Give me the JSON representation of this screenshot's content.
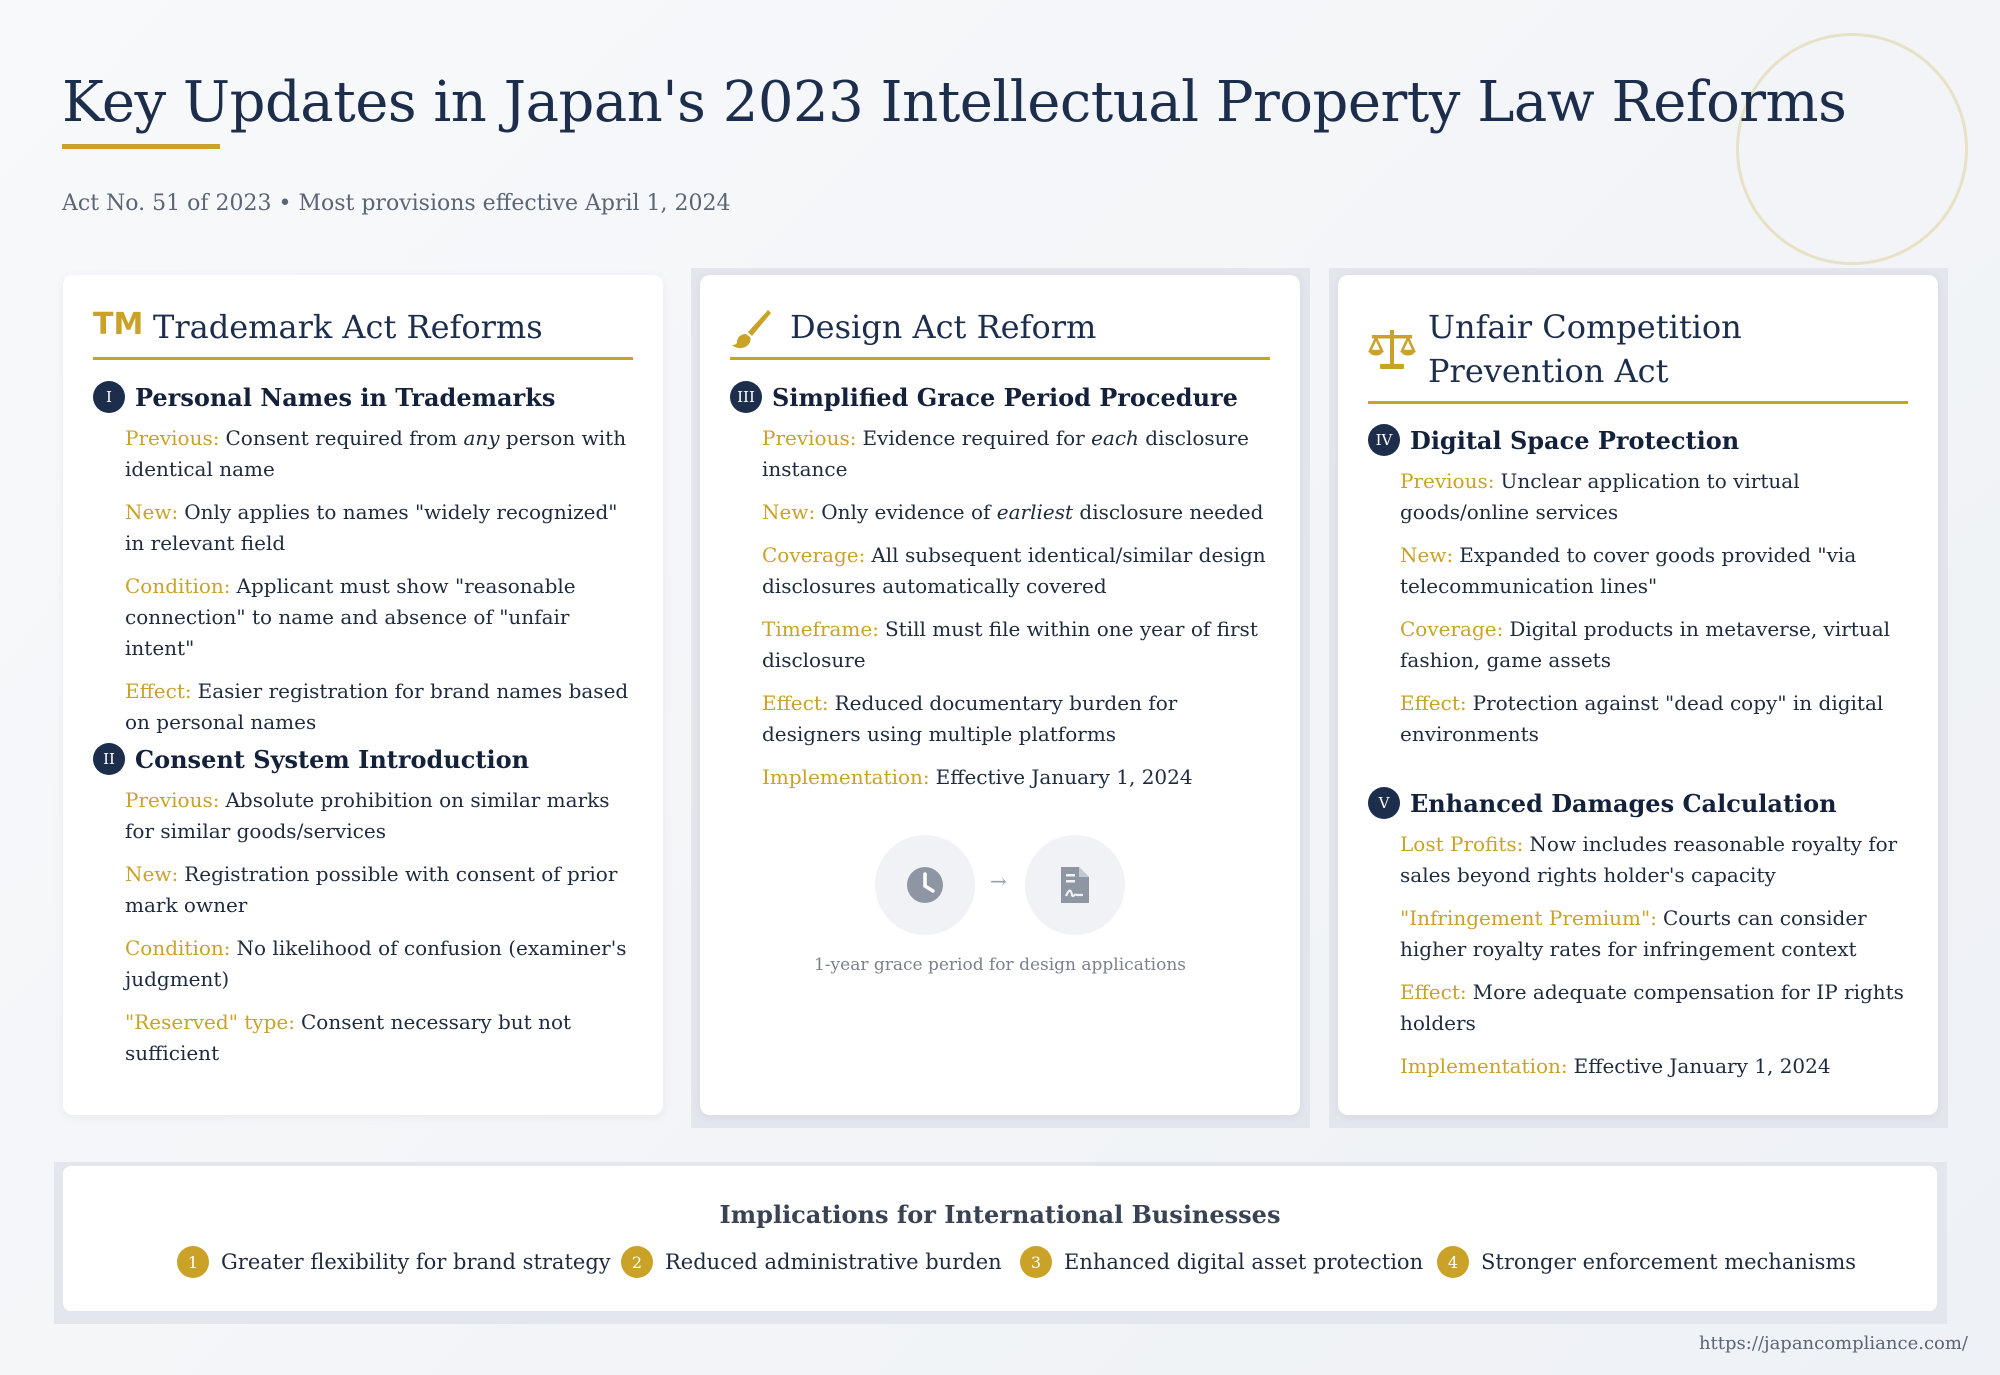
{
  "header": {
    "title": "Key Updates in Japan's 2023 Intellectual Property Law Reforms",
    "subtitle": "Act No. 51 of 2023 • Most provisions effective April 1, 2024"
  },
  "colors": {
    "navy": "#1c2e4c",
    "gold": "#c9a227"
  },
  "cards": {
    "trademark": {
      "icon": "trademark-icon",
      "icon_text": "TM",
      "title": "Trademark Act Reforms",
      "sections": [
        {
          "num": "I",
          "title": "Personal Names in Trademarks",
          "items": [
            {
              "label": "Previous:",
              "pre": "Consent required from ",
              "em": "any",
              "post": " person with identical name"
            },
            {
              "label": "New:",
              "text": "Only applies to names \"widely recognized\" in relevant field"
            },
            {
              "label": "Condition:",
              "text": "Applicant must show \"reasonable connection\" to name and absence of \"unfair intent\""
            },
            {
              "label": "Effect:",
              "text": "Easier registration for brand names based on personal names"
            }
          ]
        },
        {
          "num": "II",
          "title": "Consent System Introduction",
          "items": [
            {
              "label": "Previous:",
              "text": "Absolute prohibition on similar marks for similar goods/services"
            },
            {
              "label": "New:",
              "text": "Registration possible with consent of prior mark owner"
            },
            {
              "label": "Condition:",
              "text": "No likelihood of confusion (examiner's judgment)"
            },
            {
              "label": "\"Reserved\" type:",
              "text": "Consent necessary but not sufficient"
            }
          ]
        }
      ]
    },
    "design": {
      "icon": "paintbrush-icon",
      "title": "Design Act Reform",
      "sections": [
        {
          "num": "III",
          "title": "Simplified Grace Period Procedure",
          "items": [
            {
              "label": "Previous:",
              "pre": "Evidence required for ",
              "em": "each",
              "post": " disclosure instance"
            },
            {
              "label": "New:",
              "pre": "Only evidence of ",
              "em": "earliest",
              "post": " disclosure needed"
            },
            {
              "label": "Coverage:",
              "text": "All subsequent identical/similar design disclosures automatically covered"
            },
            {
              "label": "Timeframe:",
              "text": "Still must file within one year of first disclosure"
            },
            {
              "label": "Effect:",
              "text": "Reduced documentary burden for designers using multiple platforms"
            },
            {
              "label": "Implementation:",
              "text": "Effective January 1, 2024"
            }
          ]
        }
      ],
      "graphic": {
        "left_icon": "clock-icon",
        "arrow": "→",
        "right_icon": "signed-document-icon",
        "caption": "1-year grace period for design applications"
      }
    },
    "unfair": {
      "icon": "scales-icon",
      "title": "Unfair Competition Prevention Act",
      "sections": [
        {
          "num": "IV",
          "title": "Digital Space Protection",
          "items": [
            {
              "label": "Previous:",
              "text": "Unclear application to virtual goods/online services"
            },
            {
              "label": "New:",
              "text": "Expanded to cover goods provided \"via telecommunication lines\""
            },
            {
              "label": "Coverage:",
              "text": "Digital products in metaverse, virtual fashion, game assets"
            },
            {
              "label": "Effect:",
              "text": "Protection against \"dead copy\" in digital environments"
            }
          ]
        },
        {
          "num": "V",
          "title": "Enhanced Damages Calculation",
          "items": [
            {
              "label": "Lost Profits:",
              "text": "Now includes reasonable royalty for sales beyond rights holder's capacity"
            },
            {
              "label": "\"Infringement Premium\":",
              "text": "Courts can consider higher royalty rates for infringement context"
            },
            {
              "label": "Effect:",
              "text": "More adequate compensation for IP rights holders"
            },
            {
              "label": "Implementation:",
              "text": "Effective January 1, 2024"
            }
          ]
        }
      ]
    }
  },
  "implications": {
    "title": "Implications for International Businesses",
    "items": [
      {
        "num": "1",
        "text": "Greater flexibility for brand strategy"
      },
      {
        "num": "2",
        "text": "Reduced administrative burden"
      },
      {
        "num": "3",
        "text": "Enhanced digital asset protection"
      },
      {
        "num": "4",
        "text": "Stronger enforcement mechanisms"
      }
    ]
  },
  "footer": {
    "url": "https://japancompliance.com/"
  }
}
